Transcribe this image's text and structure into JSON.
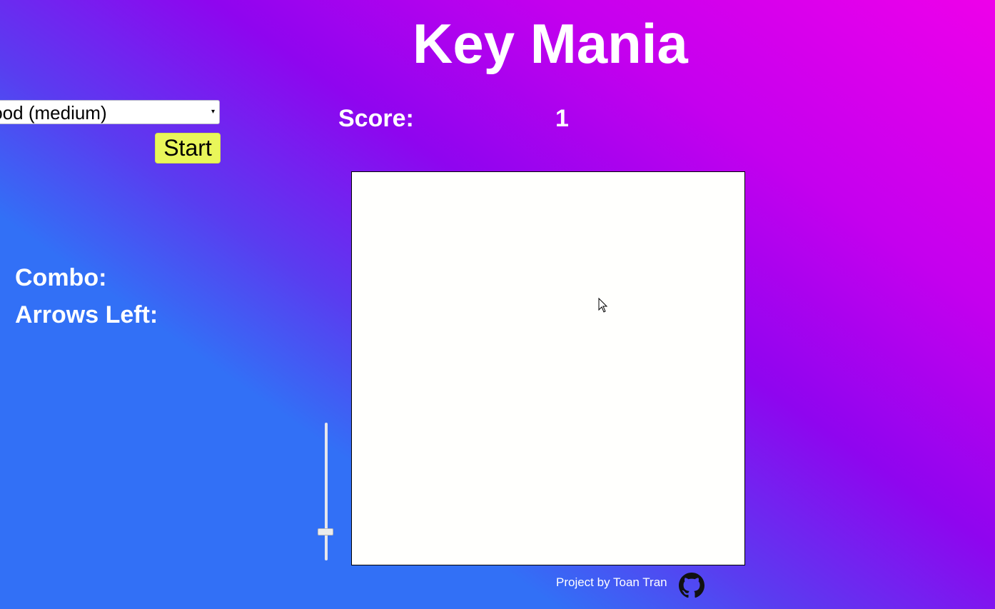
{
  "app": {
    "title": "Key Mania"
  },
  "controls": {
    "difficulty_selected": "Good (medium)",
    "start_label": "Start",
    "speed_slider_level": 0.19
  },
  "stats": {
    "score_label": "Score:",
    "score_value": "1",
    "combo_label": "Combo:",
    "arrows_left_label": "Arrows Left:"
  },
  "footer": {
    "credit": "Project by Toan Tran",
    "icon": "github-icon"
  },
  "colors": {
    "start_button": "#e9f65a",
    "board": "#fffffd",
    "gradient_start": "#3270f6",
    "gradient_mid": "#8f05ef",
    "gradient_end": "#ee00ea"
  }
}
